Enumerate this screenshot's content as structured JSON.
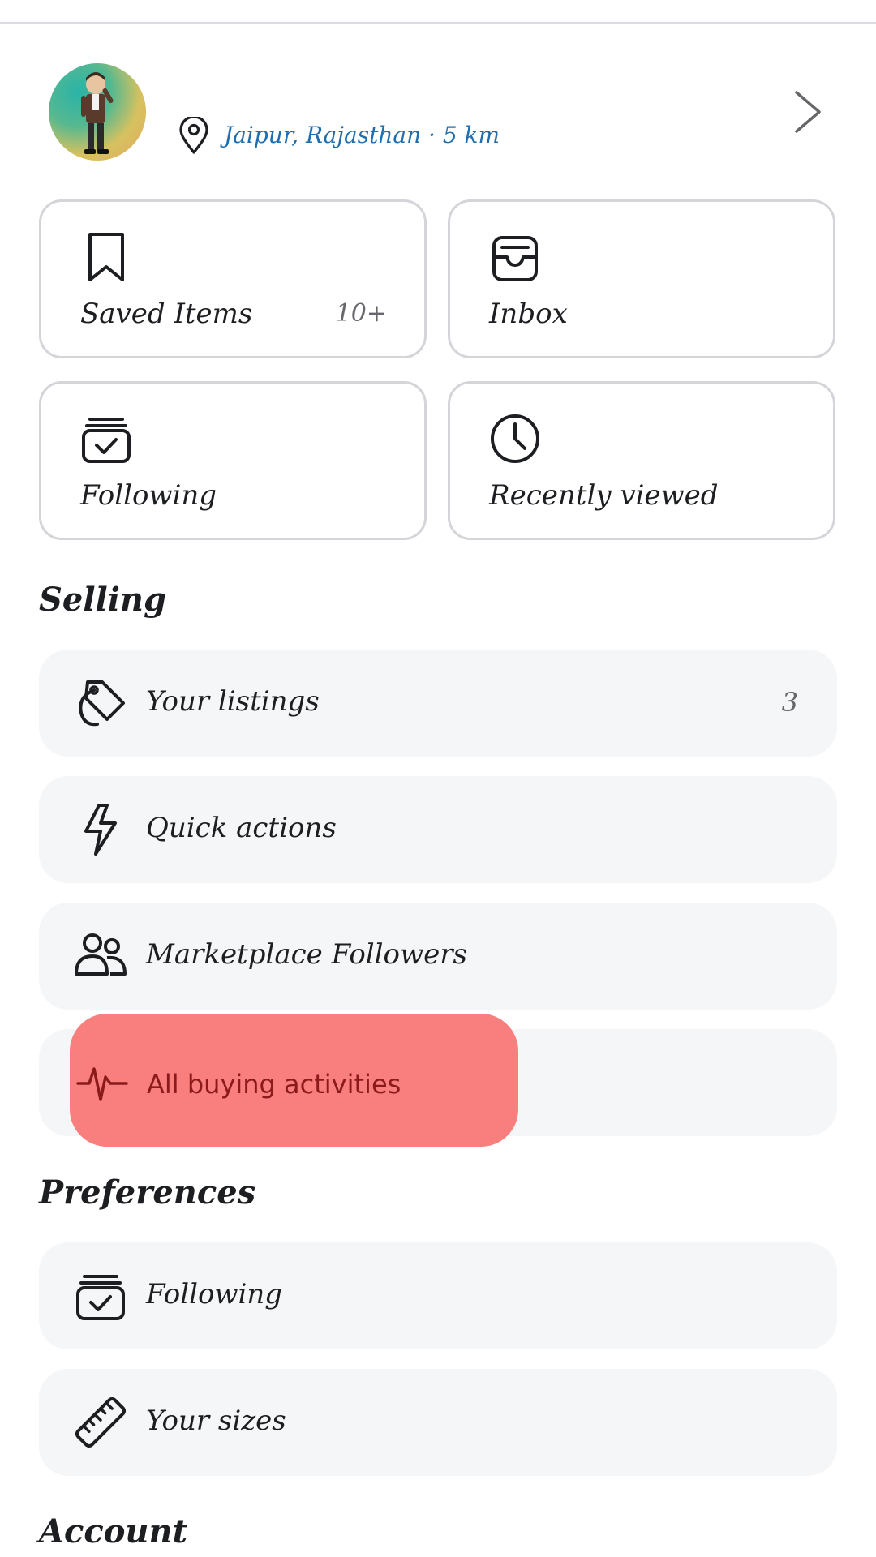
{
  "profile": {
    "location": "Jaipur, Rajasthan · 5 km"
  },
  "tiles": [
    {
      "label": "Saved Items",
      "count": "10+"
    },
    {
      "label": "Inbox"
    },
    {
      "label": "Following"
    },
    {
      "label": "Recently viewed"
    }
  ],
  "sections": {
    "selling": "Selling",
    "preferences": "Preferences",
    "account": "Account"
  },
  "selling_items": [
    {
      "label": "Your listings",
      "count": "3"
    },
    {
      "label": "Quick actions"
    },
    {
      "label": "Marketplace Followers"
    },
    {
      "label": "All buying activities"
    }
  ],
  "preference_items": [
    {
      "label": "Following"
    },
    {
      "label": "Your sizes"
    }
  ],
  "colors": {
    "accent_link": "#1f6fb0",
    "highlight": "#f97e7e",
    "row_bg": "#f5f6f7"
  }
}
